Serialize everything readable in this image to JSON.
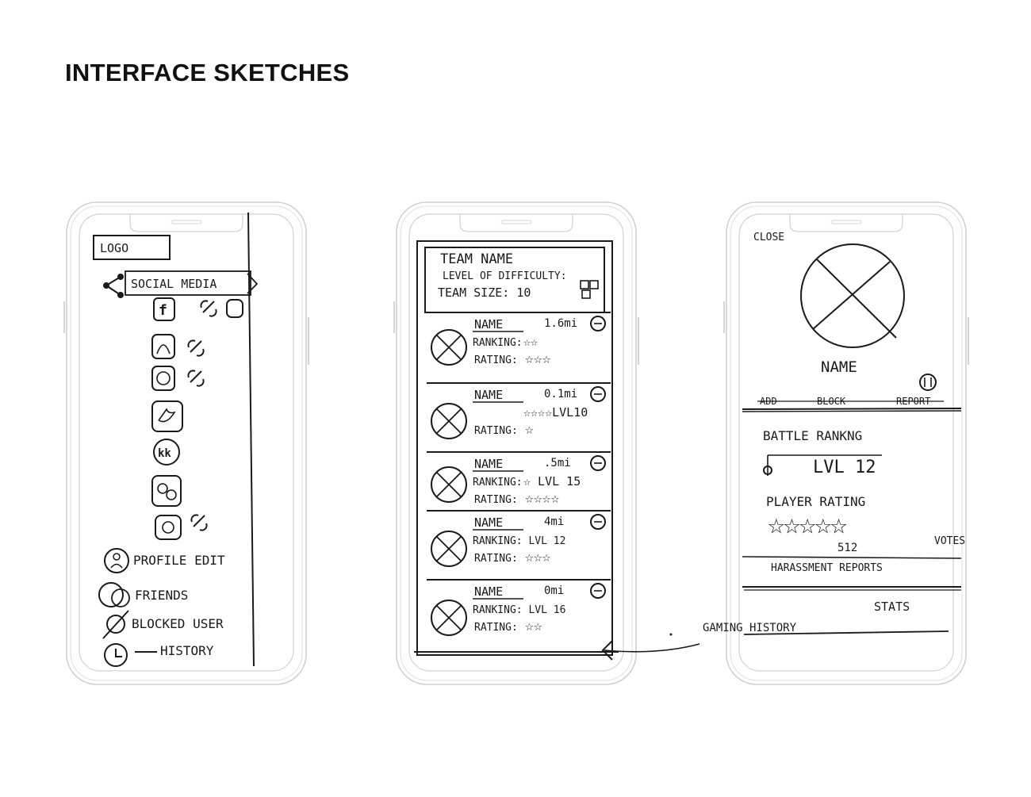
{
  "page": {
    "title": "INTERFACE SKETCHES"
  },
  "menu_phone": {
    "logo": "LOGO",
    "social_media": "SOCIAL MEDIA",
    "profile_edit": "PROFILE EDIT",
    "friends": "FRIENDS",
    "blocked_user": "BLOCKED USER",
    "history": "HISTORY",
    "social_icons": [
      "facebook-icon",
      "snapchat-icon",
      "reddit-icon",
      "twitter-icon",
      "kik-icon",
      "wechat-icon",
      "instagram-icon"
    ]
  },
  "team_phone": {
    "team_name": "TEAM NAME",
    "level_of_difficulty": "LEVEL OF DIFFICULTY:",
    "team_size": "TEAM SIZE: 10",
    "players": [
      {
        "name": "NAME",
        "distance": "1.6mi",
        "line1": "RANKING:",
        "line2": "RATING:",
        "stars1": "☆☆",
        "stars2": "☆☆☆"
      },
      {
        "name": "NAME",
        "distance": "0.1mi",
        "line1": "",
        "line2": "RATING:",
        "stars1": "☆☆☆☆LVL10",
        "stars2": "☆"
      },
      {
        "name": "NAME",
        "distance": ".5mi",
        "line1": "RANKING:",
        "line2": "RATING:",
        "stars1": "☆ LVL 15",
        "stars2": "☆☆☆☆"
      },
      {
        "name": "NAME",
        "distance": "4mi",
        "line1": "RANKING: LVL 12",
        "line2": "RATING:",
        "stars1": "",
        "stars2": "☆☆☆"
      },
      {
        "name": "NAME",
        "distance": "0mi",
        "line1": "RANKING: LVL 16",
        "line2": "RATING:",
        "stars1": "",
        "stars2": "☆☆"
      }
    ]
  },
  "profile_phone": {
    "close": "CLOSE",
    "name": "NAME",
    "add": "ADD",
    "block": "BLOCK",
    "report": "REPORT",
    "battle_ranking": "BATTLE RANKNG",
    "level": "LVL 12",
    "player_rating": "PLAYER RATING",
    "rating_stars": "☆☆☆☆☆",
    "votes_count": "512",
    "votes": "VOTES",
    "harassment_reports": "HARASSMENT REPORTS",
    "stats": "STATS",
    "gaming_history": "GAMING HISTORY"
  }
}
